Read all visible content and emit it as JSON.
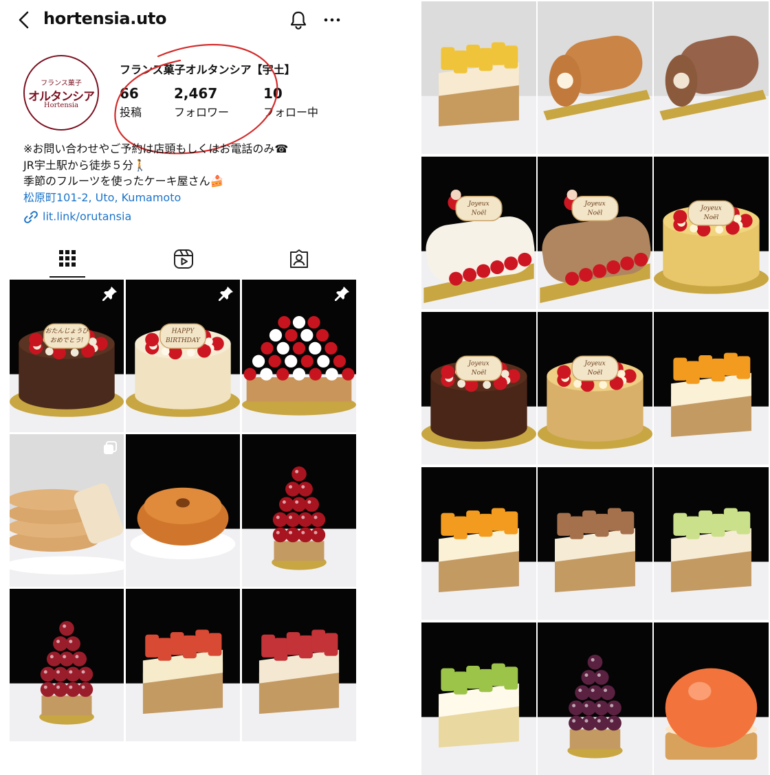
{
  "header": {
    "username": "hortensia.uto"
  },
  "profile": {
    "avatar_lines": [
      "フランス菓子",
      "オルタンシア",
      "Hortensia"
    ],
    "display_name": "フランス菓子オルタンシア【宇土】",
    "stats": [
      {
        "value": "66",
        "label": "投稿"
      },
      {
        "value": "2,467",
        "label": "フォロワー"
      },
      {
        "value": "10",
        "label": "フォロー中"
      }
    ],
    "bio_lines": [
      "※お問い合わせやご予約は店頭もしくはお電話のみ☎",
      "JR宇土駅から徒歩５分🚶",
      "季節のフルーツを使ったケーキ屋さん🍰"
    ],
    "location": "松原町101-2, Uto, Kumamoto",
    "link": "lit.link/orutansia"
  },
  "tabs": [
    "grid-tab",
    "reels-tab",
    "tagged-tab"
  ],
  "colors": {
    "accent": "#1a73c9",
    "brand": "#7a1020",
    "annotation": "#d42a2a"
  },
  "grid_posts": [
    {
      "kind": "chocolate-birthday-cake",
      "pinned": true,
      "plaque": [
        "おたんじょうび",
        "おめでとう!"
      ]
    },
    {
      "kind": "strawberry-cream-birthday-cake",
      "pinned": true,
      "plaque": [
        "HAPPY",
        "BIRTHDAY"
      ]
    },
    {
      "kind": "strawberry-tart",
      "pinned": true
    },
    {
      "kind": "cookies",
      "carousel": true
    },
    {
      "kind": "bundt-cake"
    },
    {
      "kind": "cherry-tart"
    },
    {
      "kind": "grape-tart"
    },
    {
      "kind": "fruit-tart-slice"
    },
    {
      "kind": "berry-tart-slice"
    }
  ],
  "right_posts": [
    {
      "kind": "pineapple-tart"
    },
    {
      "kind": "roll-cake"
    },
    {
      "kind": "chocolate-roll-cake"
    },
    {
      "kind": "white-buche-de-noel",
      "plaque": [
        "Joyeux",
        "Noël"
      ]
    },
    {
      "kind": "chestnut-buche-de-noel",
      "plaque": [
        "Joyeux",
        "Noël"
      ]
    },
    {
      "kind": "cheese-christmas-cake",
      "plaque": [
        "Joyeux",
        "Noël"
      ]
    },
    {
      "kind": "chocolate-christmas-cake",
      "plaque": [
        "Joyeux",
        "Noël"
      ]
    },
    {
      "kind": "christmas-tart",
      "plaque": [
        "Joyeux",
        "Noël"
      ]
    },
    {
      "kind": "mango-cake"
    },
    {
      "kind": "mango-tart"
    },
    {
      "kind": "fig-tart"
    },
    {
      "kind": "melon-tart"
    },
    {
      "kind": "grape-shortcake"
    },
    {
      "kind": "grape-tartlet"
    },
    {
      "kind": "peach-dome"
    }
  ]
}
